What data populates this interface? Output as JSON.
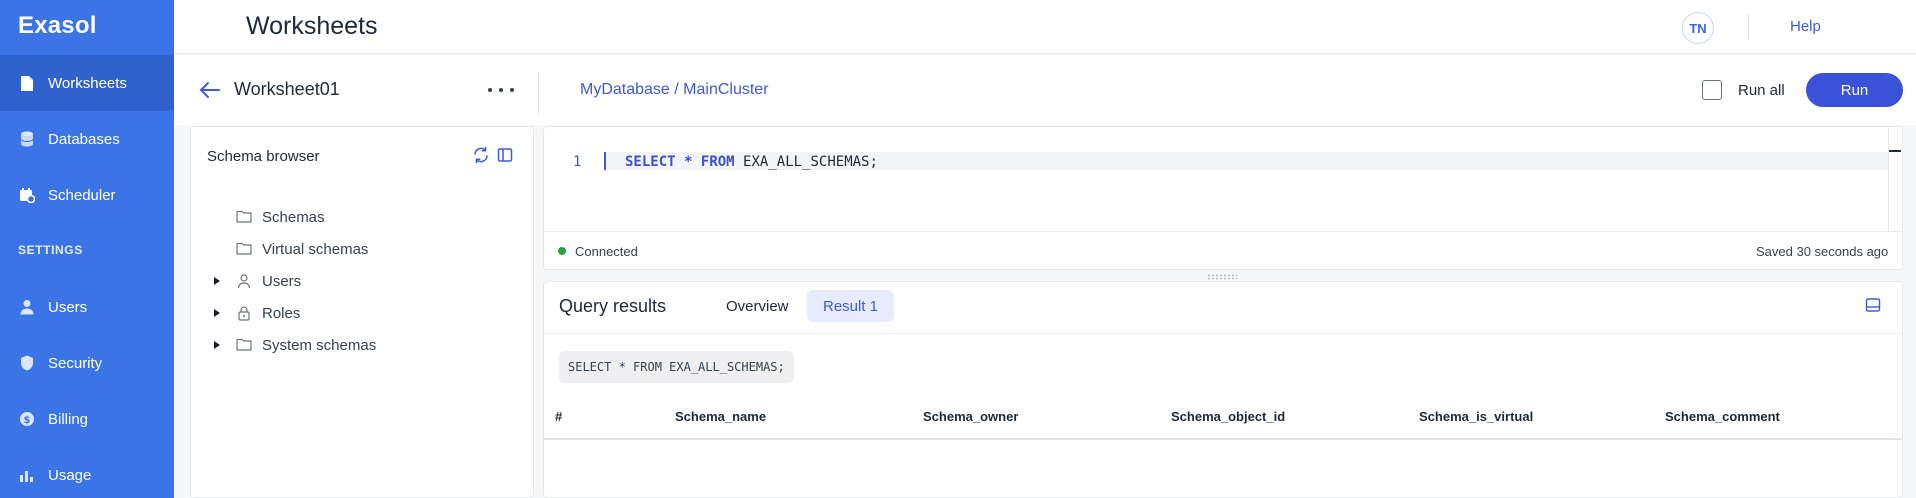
{
  "sidebar": {
    "logo": "Exasol",
    "items": [
      {
        "label": "Worksheets",
        "icon": "file-icon",
        "active": true
      },
      {
        "label": "Databases",
        "icon": "database-icon"
      },
      {
        "label": "Scheduler",
        "icon": "calendar-icon"
      },
      {
        "label": "Users",
        "icon": "user-icon"
      },
      {
        "label": "Security",
        "icon": "shield-icon"
      },
      {
        "label": "Billing",
        "icon": "dollar-circle-icon"
      },
      {
        "label": "Usage",
        "icon": "bar-chart-icon"
      }
    ],
    "section_settings": "SETTINGS"
  },
  "header": {
    "title": "Worksheets",
    "avatar_initials": "TN",
    "help_label": "Help"
  },
  "worksheet": {
    "name": "Worksheet01",
    "db_path": "MyDatabase / MainCluster",
    "run_all_label": "Run all",
    "run_all_checked": false,
    "run_label": "Run"
  },
  "schema_browser": {
    "title": "Schema browser",
    "items": [
      {
        "label": "Schemas",
        "icon": "folder-icon",
        "expandable": false
      },
      {
        "label": "Virtual schemas",
        "icon": "folder-icon",
        "expandable": false
      },
      {
        "label": "Users",
        "icon": "user-icon",
        "expandable": true
      },
      {
        "label": "Roles",
        "icon": "lock-icon",
        "expandable": true
      },
      {
        "label": "System schemas",
        "icon": "folder-icon",
        "expandable": true
      }
    ]
  },
  "editor": {
    "line_number": "1",
    "code_kw1": "SELECT",
    "code_star": "*",
    "code_kw2": "FROM",
    "code_rest": "EXA_ALL_SCHEMAS;",
    "status": "Connected",
    "status_color": "#22a34a",
    "saved": "Saved 30 seconds ago"
  },
  "results": {
    "title": "Query results",
    "tabs": [
      "Overview",
      "Result 1"
    ],
    "active_tab": "Result 1",
    "query": "SELECT * FROM EXA_ALL_SCHEMAS;",
    "columns": [
      "#",
      "Schema_name",
      "Schema_owner",
      "Schema_object_id",
      "Schema_is_virtual",
      "Schema_comment"
    ]
  },
  "colors": {
    "sidebar": "#3b74e6",
    "accent": "#3b51d8",
    "link": "#3b5bdb"
  }
}
